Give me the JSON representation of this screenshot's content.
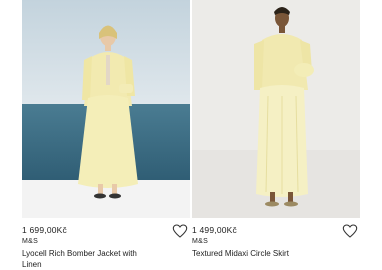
{
  "products": [
    {
      "price": "1 699,00Kč",
      "brand": "M&S",
      "title": "Lyocell Rich Bomber Jacket with Linen",
      "image_desc": "model-sea-backdrop"
    },
    {
      "price": "1 499,00Kč",
      "brand": "M&S",
      "title": "Textured Midaxi Circle Skirt",
      "image_desc": "model-studio-backdrop"
    }
  ],
  "colors": {
    "garment": "#f2eab0",
    "sea": "#3f6f85",
    "sky": "#cfdde6",
    "studio": "#ecebe8"
  },
  "icons": {
    "wishlist": "heart-outline-icon"
  }
}
